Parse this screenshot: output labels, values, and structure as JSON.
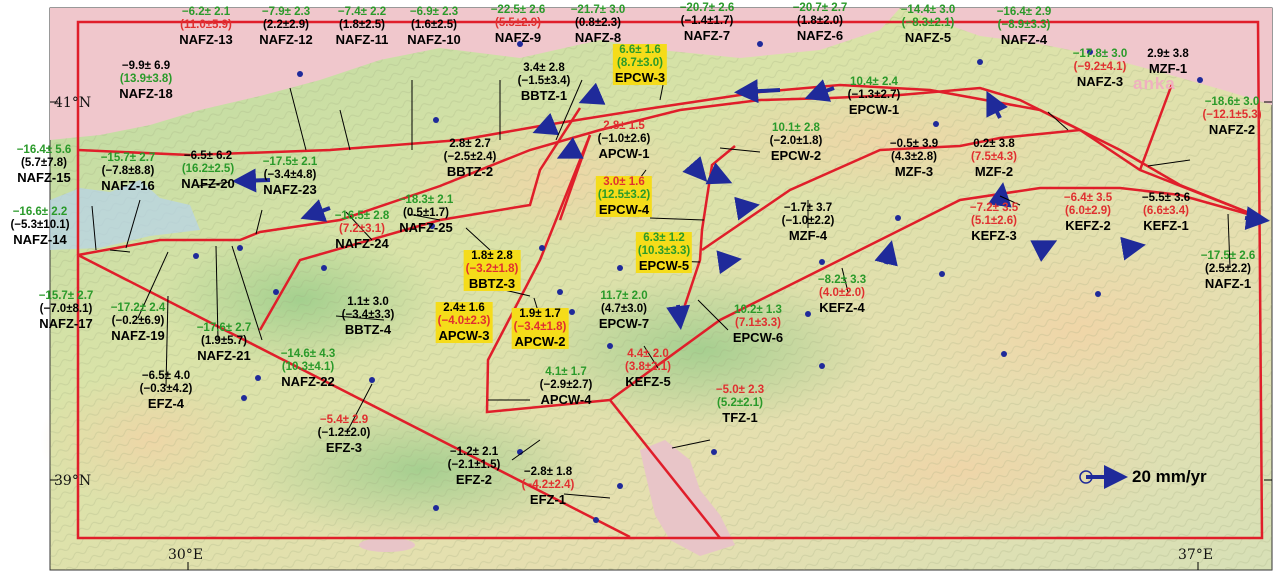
{
  "colors": {
    "green": "#2a9a2a",
    "red": "#e03030",
    "black": "#000000",
    "fault_line": "#e01e2a",
    "arrow": "#1f2a9a",
    "highlight": "#f5dc1a"
  },
  "axes": {
    "lat_top": "41°N",
    "lat_bottom": "39°N",
    "lon_left": "30°E",
    "lon_right": "37°E"
  },
  "legend": {
    "scale_label": "20 mm/yr"
  },
  "watermark": "anka",
  "blocks": [
    {
      "id": "nafz13",
      "name": "NAFZ-13",
      "v1": "−6.2± 2.1",
      "c1": "green",
      "v2": "(11.0±5.9)",
      "c2": "red"
    },
    {
      "id": "nafz12",
      "name": "NAFZ-12",
      "v1": "−7.9± 2.3",
      "c1": "green",
      "v2": "(2.2±2.9)",
      "c2": "black"
    },
    {
      "id": "nafz11",
      "name": "NAFZ-11",
      "v1": "−7.4± 2.2",
      "c1": "green",
      "v2": "(1.8±2.5)",
      "c2": "black"
    },
    {
      "id": "nafz10",
      "name": "NAFZ-10",
      "v1": "−6.9± 2.3",
      "c1": "green",
      "v2": "(1.6±2.5)",
      "c2": "black"
    },
    {
      "id": "nafz9",
      "name": "NAFZ-9",
      "v1": "−22.5± 2.6",
      "c1": "green",
      "v2": "(5.5±2.9)",
      "c2": "red"
    },
    {
      "id": "nafz8",
      "name": "NAFZ-8",
      "v1": "−21.7± 3.0",
      "c1": "green",
      "v2": "(0.8±2.3)",
      "c2": "black"
    },
    {
      "id": "nafz7",
      "name": "NAFZ-7",
      "v1": "−20.7± 2.6",
      "c1": "green",
      "v2": "(−1.4±1.7)",
      "c2": "black"
    },
    {
      "id": "nafz6",
      "name": "NAFZ-6",
      "v1": "−20.7± 2.7",
      "c1": "green",
      "v2": "(1.8±2.0)",
      "c2": "black"
    },
    {
      "id": "nafz5",
      "name": "NAFZ-5",
      "v1": "−14.4± 3.0",
      "c1": "green",
      "v2": "(−8.3±2.1)",
      "c2": "green"
    },
    {
      "id": "nafz4",
      "name": "NAFZ-4",
      "v1": "−16.4± 2.9",
      "c1": "green",
      "v2": "(−8.9±3.3)",
      "c2": "green"
    },
    {
      "id": "nafz3",
      "name": "NAFZ-3",
      "v1": "−17.8± 3.0",
      "c1": "green",
      "v2": "(−9.2±4.1)",
      "c2": "red"
    },
    {
      "id": "mzf1",
      "name": "MZF-1",
      "v1": "2.9± 3.8",
      "c1": "black",
      "v2": "",
      "c2": "black"
    },
    {
      "id": "nafz2",
      "name": "NAFZ-2",
      "v1": "−18.6± 3.0",
      "c1": "green",
      "v2": "(−12.1±5.3)",
      "c2": "red"
    },
    {
      "id": "nafz18",
      "name": "NAFZ-18",
      "v1": "−9.9± 6.9",
      "c1": "black",
      "v2": "(13.9±3.8)",
      "c2": "green"
    },
    {
      "id": "bbtz1",
      "name": "BBTZ-1",
      "v1": "3.4± 2.8",
      "c1": "black",
      "v2": "(−1.5±3.4)",
      "c2": "black"
    },
    {
      "id": "epcw3",
      "name": "EPCW-3",
      "v1": "6.6± 1.6",
      "c1": "green",
      "v2": "(8.7±3.0)",
      "c2": "green",
      "hl": true
    },
    {
      "id": "epcw1",
      "name": "EPCW-1",
      "v1": "10.4± 2.4",
      "c1": "green",
      "v2": "(−1.3±2.7)",
      "c2": "black"
    },
    {
      "id": "apcw1",
      "name": "APCW-1",
      "v1": "2.8± 1.5",
      "c1": "red",
      "v2": "(−1.0±2.6)",
      "c2": "black"
    },
    {
      "id": "epcw2",
      "name": "EPCW-2",
      "v1": "10.1± 2.8",
      "c1": "green",
      "v2": "(−2.0±1.8)",
      "c2": "black"
    },
    {
      "id": "mzf3",
      "name": "MZF-3",
      "v1": "−0.5± 3.9",
      "c1": "black",
      "v2": "(4.3±2.8)",
      "c2": "black"
    },
    {
      "id": "mzf2",
      "name": "MZF-2",
      "v1": "0.2± 3.8",
      "c1": "black",
      "v2": "(7.5±4.3)",
      "c2": "red"
    },
    {
      "id": "nafz15",
      "name": "NAFZ-15",
      "v1": "−16.4± 5.6",
      "c1": "green",
      "v2": "(5.7±7.8)",
      "c2": "black"
    },
    {
      "id": "nafz16",
      "name": "NAFZ-16",
      "v1": "−15.7± 2.7",
      "c1": "green",
      "v2": "(−7.8±8.8)",
      "c2": "black"
    },
    {
      "id": "nafz20",
      "name": "NAFZ-20",
      "v1": "−6.5± 6.2",
      "c1": "black",
      "v2": "(16.2±2.5)",
      "c2": "green"
    },
    {
      "id": "nafz23",
      "name": "NAFZ-23",
      "v1": "−17.5± 2.1",
      "c1": "green",
      "v2": "(−3.4±4.8)",
      "c2": "black"
    },
    {
      "id": "bbtz2",
      "name": "BBTZ-2",
      "v1": "2.8± 2.7",
      "c1": "black",
      "v2": "(−2.5±2.4)",
      "c2": "black"
    },
    {
      "id": "epcw4",
      "name": "EPCW-4",
      "v1": "3.0± 1.6",
      "c1": "red",
      "v2": "(12.5±3.2)",
      "c2": "green",
      "hl": true
    },
    {
      "id": "mzf4",
      "name": "MZF-4",
      "v1": "−1.7± 3.7",
      "c1": "black",
      "v2": "(−1.0±2.2)",
      "c2": "black"
    },
    {
      "id": "kefz3",
      "name": "KEFZ-3",
      "v1": "−7.2± 3.5",
      "c1": "red",
      "v2": "(5.1±2.6)",
      "c2": "red"
    },
    {
      "id": "kefz2",
      "name": "KEFZ-2",
      "v1": "−6.4± 3.5",
      "c1": "red",
      "v2": "(6.0±2.9)",
      "c2": "red"
    },
    {
      "id": "kefz1",
      "name": "KEFZ-1",
      "v1": "−5.5± 3.6",
      "c1": "black",
      "v2": "(6.6±3.4)",
      "c2": "red"
    },
    {
      "id": "nafz14",
      "name": "NAFZ-14",
      "v1": "−16.6± 2.2",
      "c1": "green",
      "v2": "(−5.3±10.1)",
      "c2": "black"
    },
    {
      "id": "nafz24",
      "name": "NAFZ-24",
      "v1": "−16.5± 2.8",
      "c1": "green",
      "v2": "(7.2±3.1)",
      "c2": "red"
    },
    {
      "id": "nafz25",
      "name": "NAFZ-25",
      "v1": "−18.3± 2.1",
      "c1": "green",
      "v2": "(0.5±1.7)",
      "c2": "black"
    },
    {
      "id": "bbtz3",
      "name": "BBTZ-3",
      "v1": "1.8± 2.8",
      "c1": "black",
      "v2": "(−3.2±1.8)",
      "c2": "red",
      "hl": true
    },
    {
      "id": "epcw5",
      "name": "EPCW-5",
      "v1": "6.3± 1.2",
      "c1": "green",
      "v2": "(10.3±3.3)",
      "c2": "green",
      "hl": true
    },
    {
      "id": "nafz1",
      "name": "NAFZ-1",
      "v1": "−17.5± 2.6",
      "c1": "green",
      "v2": "(2.5±2.2)",
      "c2": "black"
    },
    {
      "id": "kefz4",
      "name": "KEFZ-4",
      "v1": "−8.2± 3.3",
      "c1": "green",
      "v2": "(4.0±2.0)",
      "c2": "red"
    },
    {
      "id": "nafz17",
      "name": "NAFZ-17",
      "v1": "−15.7± 2.7",
      "c1": "green",
      "v2": "(−7.0±8.1)",
      "c2": "black"
    },
    {
      "id": "nafz19",
      "name": "NAFZ-19",
      "v1": "−17.2± 2.4",
      "c1": "green",
      "v2": "(−0.2±6.9)",
      "c2": "black"
    },
    {
      "id": "bbtz4",
      "name": "BBTZ-4",
      "v1": "1.1± 3.0",
      "c1": "black",
      "v2": "(−3.4±3.3)",
      "c2": "black"
    },
    {
      "id": "apcw3",
      "name": "APCW-3",
      "v1": "2.4± 1.6",
      "c1": "black",
      "v2": "(−4.0±2.3)",
      "c2": "red",
      "hl": true
    },
    {
      "id": "apcw2",
      "name": "APCW-2",
      "v1": "1.9± 1.7",
      "c1": "black",
      "v2": "(−3.4±1.8)",
      "c2": "red",
      "hl": true
    },
    {
      "id": "epcw7",
      "name": "EPCW-7",
      "v1": "11.7± 2.0",
      "c1": "green",
      "v2": "(4.7±3.0)",
      "c2": "black"
    },
    {
      "id": "epcw6",
      "name": "EPCW-6",
      "v1": "10.2± 1.3",
      "c1": "green",
      "v2": "(7.1±3.3)",
      "c2": "red"
    },
    {
      "id": "nafz21",
      "name": "NAFZ-21",
      "v1": "−17.6± 2.7",
      "c1": "green",
      "v2": "(1.9±5.7)",
      "c2": "black"
    },
    {
      "id": "nafz22",
      "name": "NAFZ-22",
      "v1": "−14.6± 4.3",
      "c1": "green",
      "v2": "(10.3±4.1)",
      "c2": "green"
    },
    {
      "id": "kefz5",
      "name": "KEFZ-5",
      "v1": "4.4± 2.0",
      "c1": "red",
      "v2": "(3.8±2.1)",
      "c2": "red"
    },
    {
      "id": "efz4",
      "name": "EFZ-4",
      "v1": "−6.5± 4.0",
      "c1": "black",
      "v2": "(−0.3±4.2)",
      "c2": "black"
    },
    {
      "id": "apcw4",
      "name": "APCW-4",
      "v1": "4.1± 1.7",
      "c1": "green",
      "v2": "(−2.9±2.7)",
      "c2": "black"
    },
    {
      "id": "tfz1",
      "name": "TFZ-1",
      "v1": "−5.0± 2.3",
      "c1": "red",
      "v2": "(5.2±2.1)",
      "c2": "green"
    },
    {
      "id": "efz3",
      "name": "EFZ-3",
      "v1": "−5.4± 2.9",
      "c1": "red",
      "v2": "(−1.2±2.0)",
      "c2": "black"
    },
    {
      "id": "efz2",
      "name": "EFZ-2",
      "v1": "−1.2± 2.1",
      "c1": "black",
      "v2": "(−2.1±1.5)",
      "c2": "black"
    },
    {
      "id": "efz1",
      "name": "EFZ-1",
      "v1": "−2.8± 1.8",
      "c1": "black",
      "v2": "(−4.2±2.4)",
      "c2": "red"
    }
  ]
}
